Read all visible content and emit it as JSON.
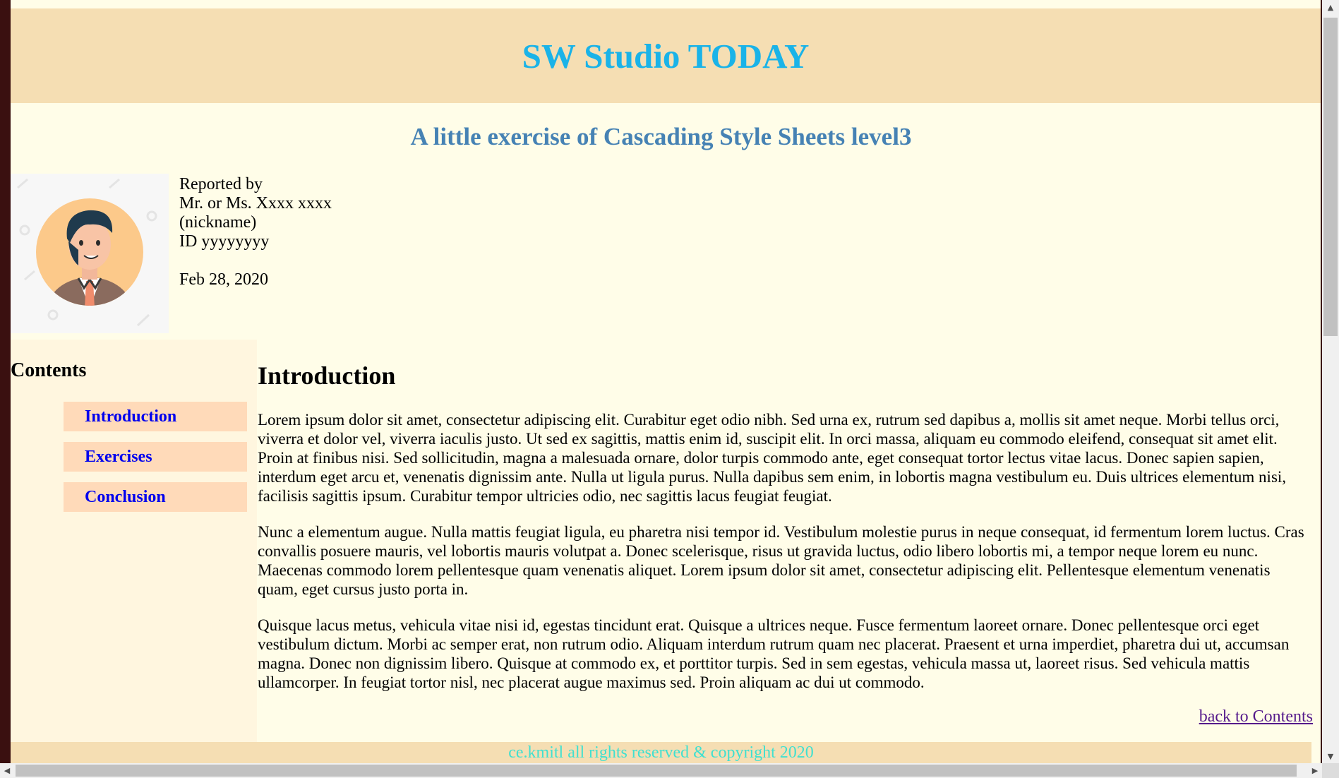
{
  "header": {
    "title": "SW Studio TODAY"
  },
  "subtitle": "A little exercise of Cascading Style Sheets level3",
  "reporter": {
    "label": "Reported by",
    "name": "Mr. or Ms. Xxxx xxxx",
    "nickname": "(nickname)",
    "id": "ID yyyyyyyy",
    "date": "Feb 28, 2020"
  },
  "sidebar": {
    "heading": "Contents",
    "items": [
      {
        "label": "Introduction"
      },
      {
        "label": "Exercises"
      },
      {
        "label": "Conclusion"
      }
    ]
  },
  "main": {
    "heading": "Introduction",
    "paragraphs": [
      "Lorem ipsum dolor sit amet, consectetur adipiscing elit. Curabitur eget odio nibh. Sed urna ex, rutrum sed dapibus a, mollis sit amet neque. Morbi tellus orci, viverra et dolor vel, viverra iaculis justo. Ut sed ex sagittis, mattis enim id, suscipit elit. In orci massa, aliquam eu commodo eleifend, consequat sit amet elit. Proin at finibus nisi. Sed sollicitudin, magna a malesuada ornare, dolor turpis commodo ante, eget consequat tortor lectus vitae lacus. Donec sapien sapien, interdum eget arcu et, venenatis dignissim ante. Nulla ut ligula purus. Nulla dapibus sem enim, in lobortis magna vestibulum eu. Duis ultrices elementum nisi, facilisis sagittis ipsum. Curabitur tempor ultricies odio, nec sagittis lacus feugiat feugiat.",
      "Nunc a elementum augue. Nulla mattis feugiat ligula, eu pharetra nisi tempor id. Vestibulum molestie purus in neque consequat, id fermentum lorem luctus. Cras convallis posuere mauris, vel lobortis mauris volutpat a. Donec scelerisque, risus ut gravida luctus, odio libero lobortis mi, a tempor neque lorem eu nunc. Maecenas commodo lorem pellentesque quam venenatis aliquet. Lorem ipsum dolor sit amet, consectetur adipiscing elit. Pellentesque elementum venenatis quam, eget cursus justo porta in.",
      "Quisque lacus metus, vehicula vitae nisi id, egestas tincidunt erat. Quisque a ultrices neque. Fusce fermentum laoreet ornare. Donec pellentesque orci eget vestibulum dictum. Morbi ac semper erat, non rutrum odio. Aliquam interdum rutrum quam nec placerat. Praesent et urna imperdiet, pharetra dui ut, accumsan magna. Donec non dignissim libero. Quisque at commodo ex, et porttitor turpis. Sed in sem egestas, vehicula massa ut, laoreet risus. Sed vehicula mattis ullamcorper. In feugiat tortor nisl, nec placerat augue maximus sed. Proin aliquam ac dui ut commodo."
    ],
    "back_link": "back to Contents"
  },
  "footer": {
    "text": "ce.kmitl all rights reserved & copyright 2020"
  },
  "colors": {
    "header_bg": "#f5deb3",
    "title": "#1ab3e8",
    "subtitle": "#4682b4",
    "nav_bg": "#ffdab9",
    "nav_link": "#0000ee",
    "footer_text": "#40e0d0",
    "page_bg": "#fffde8"
  },
  "icons": {
    "avatar": "avatar-illustration-icon"
  }
}
